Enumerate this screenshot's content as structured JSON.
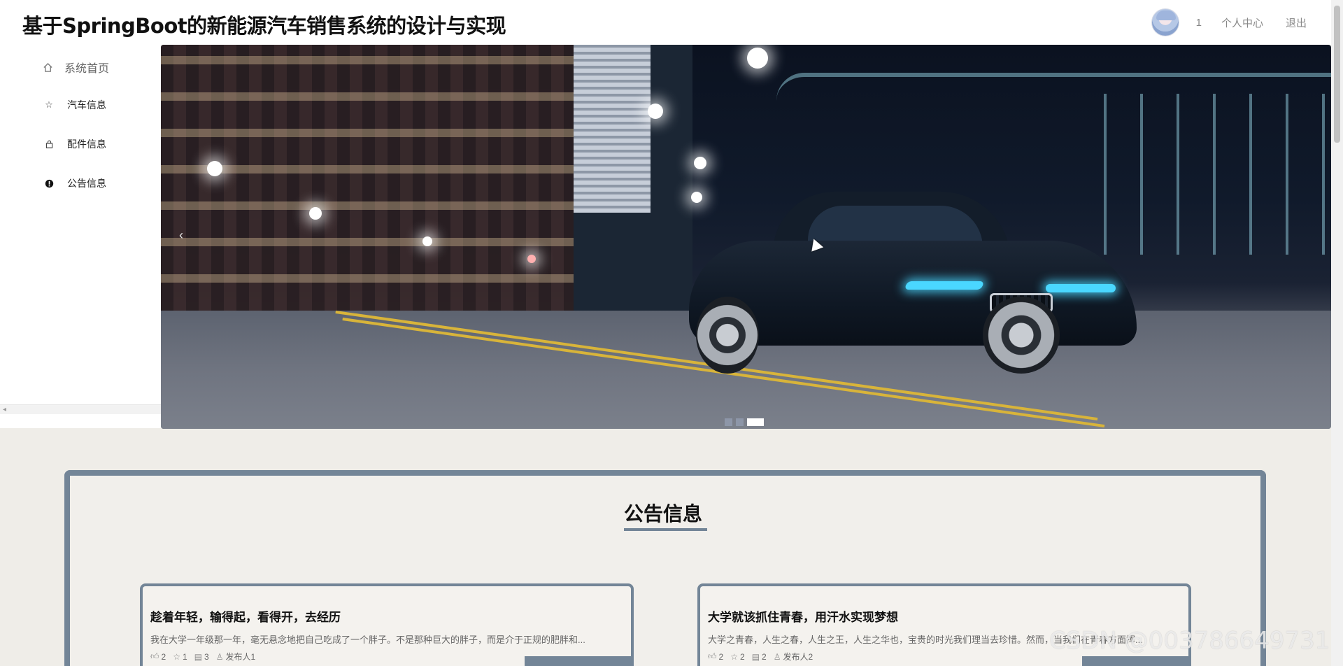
{
  "header": {
    "title": "基于SpringBoot的新能源汽车销售系统的设计与实现",
    "username": "1",
    "profile_label": "个人中心",
    "logout_label": "退出"
  },
  "sidebar": {
    "items": [
      {
        "label": "系统首页",
        "icon": "home-icon"
      },
      {
        "label": "汽车信息",
        "icon": "star-icon"
      },
      {
        "label": "配件信息",
        "icon": "bag-icon"
      },
      {
        "label": "公告信息",
        "icon": "alert-icon"
      }
    ]
  },
  "banner": {
    "prev_arrow": "‹",
    "slide_count": 3,
    "active_slide": 3
  },
  "notices": {
    "section_title": "公告信息",
    "items": [
      {
        "title": "趁着年轻，输得起，看得开，去经历",
        "excerpt": "我在大学一年级那一年，毫无悬念地把自己吃成了一个胖子。不是那种巨大的胖子，而是介于正规的肥胖和...",
        "likes": "2",
        "favorites": "1",
        "comments": "3",
        "publisher": "发布人1"
      },
      {
        "title": "大学就该抓住青春，用汗水实现梦想",
        "excerpt": "大学之青春，人生之春，人生之王，人生之华也，宝贵的时光我们理当去珍惜。然而，当我们在青春方面挥...",
        "likes": "2",
        "favorites": "2",
        "comments": "2",
        "publisher": "发布人2"
      }
    ]
  },
  "watermark": "CSDN @003786649731",
  "colors": {
    "accent": "#738597",
    "page_bg": "#efede8"
  }
}
